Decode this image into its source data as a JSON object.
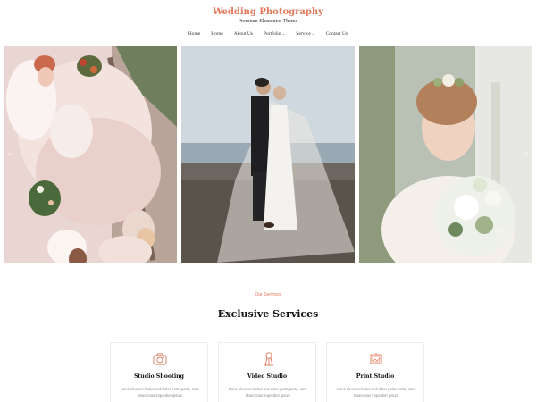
{
  "header": {
    "site_title": "Wedding Photography",
    "tagline": "Premium Elementor Theme"
  },
  "nav": {
    "items": [
      {
        "label": "Home",
        "has_dropdown": false
      },
      {
        "label": "Home",
        "has_dropdown": false
      },
      {
        "label": "About Us",
        "has_dropdown": false
      },
      {
        "label": "Portfolio",
        "has_dropdown": true
      },
      {
        "label": "Service",
        "has_dropdown": true
      },
      {
        "label": "Contact Us",
        "has_dropdown": false
      }
    ]
  },
  "slider": {
    "prev_icon": "chevron-left-icon",
    "next_icon": "chevron-right-icon",
    "prev_glyph": "‹",
    "next_glyph": "›"
  },
  "services": {
    "eyebrow": "Our Services",
    "heading": "Exclusive Services",
    "cards": [
      {
        "title": "Studio Shooting",
        "icon": "camera-icon",
        "text": "Nunc sit amet lectus sed dolor porta porta, nare Maecenas imperdiet ipsum"
      },
      {
        "title": "Video Studio",
        "icon": "spotlight-icon",
        "text": "Nunc sit amet lectus sed dolor porta porta, nare Maecenas imperdiet ipsum"
      },
      {
        "title": "Print Studio",
        "icon": "print-frame-icon",
        "text": "Nunc sit amet lectus sed dolor porta porta, nare Maecenas imperdiet ipsum"
      }
    ]
  },
  "colors": {
    "accent": "#e0785a",
    "heading": "#111111",
    "body_text": "#8a8a8a"
  }
}
